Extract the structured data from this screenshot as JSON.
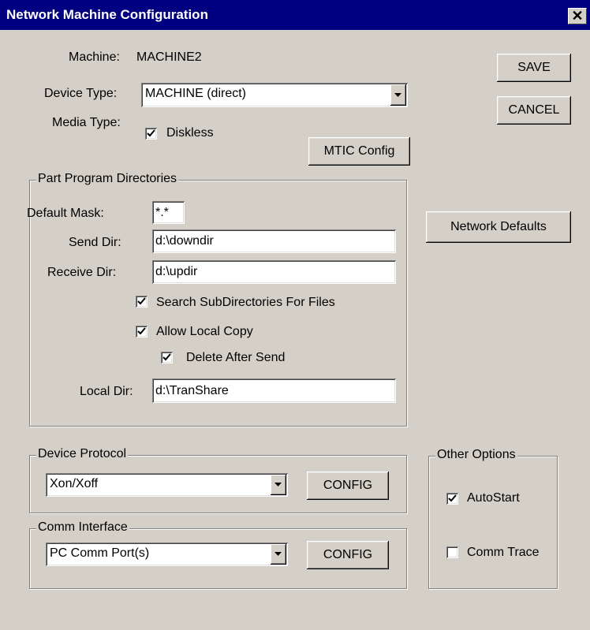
{
  "window": {
    "title": "Network Machine Configuration",
    "close_glyph": "✕"
  },
  "machine": {
    "label": "Machine:",
    "value": "MACHINE2"
  },
  "device_type": {
    "label": "Device Type:",
    "value": "MACHINE (direct)"
  },
  "media_type": {
    "label": "Media Type:",
    "diskless_label": "Diskless",
    "diskless_checked": true
  },
  "buttons": {
    "save": "SAVE",
    "cancel": "CANCEL",
    "mtic_config": "MTIC Config",
    "network_defaults": "Network Defaults"
  },
  "part_program": {
    "legend": "Part Program Directories",
    "default_mask_label": "Default Mask:",
    "default_mask_value": "*.*",
    "send_dir_label": "Send Dir:",
    "send_dir_value": "d:\\downdir",
    "receive_dir_label": "Receive Dir:",
    "receive_dir_value": "d:\\updir",
    "search_subdirs_label": "Search SubDirectories For Files",
    "search_subdirs_checked": true,
    "allow_local_copy_label": "Allow Local Copy",
    "allow_local_copy_checked": true,
    "delete_after_send_label": "Delete After Send",
    "delete_after_send_checked": true,
    "local_dir_label": "Local Dir:",
    "local_dir_value": "d:\\TranShare"
  },
  "device_protocol": {
    "legend": "Device Protocol",
    "value": "Xon/Xoff",
    "config_label": "CONFIG"
  },
  "comm_interface": {
    "legend": "Comm Interface",
    "value": "PC Comm Port(s)",
    "config_label": "CONFIG"
  },
  "other_options": {
    "legend": "Other Options",
    "autostart_label": "AutoStart",
    "autostart_checked": true,
    "comm_trace_label": "Comm Trace",
    "comm_trace_checked": false
  }
}
